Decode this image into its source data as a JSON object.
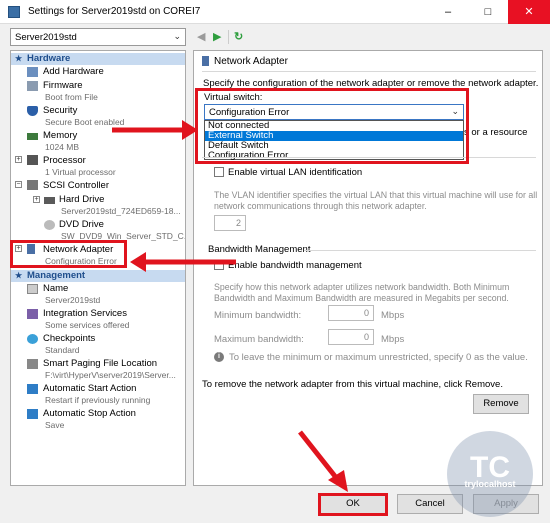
{
  "window": {
    "title": "Settings for Server2019std on COREI7",
    "minimize": "–",
    "maximize": "□",
    "close": "✕"
  },
  "vm_select": {
    "value": "Server2019std"
  },
  "toolbar": {
    "back": "◀",
    "forward": "▶",
    "refresh": "↻"
  },
  "sidebar": {
    "hardware_header": "Hardware",
    "management_header": "Management",
    "items": [
      {
        "label": "Add Hardware",
        "sub": ""
      },
      {
        "label": "Firmware",
        "sub": "Boot from File"
      },
      {
        "label": "Security",
        "sub": "Secure Boot enabled"
      },
      {
        "label": "Memory",
        "sub": "1024 MB"
      },
      {
        "label": "Processor",
        "sub": "1 Virtual processor"
      },
      {
        "label": "SCSI Controller",
        "sub": ""
      },
      {
        "label": "Hard Drive",
        "sub": "Server2019std_724ED659-18..."
      },
      {
        "label": "DVD Drive",
        "sub": "SW_DVD9_Win_Server_STD_C..."
      },
      {
        "label": "Network Adapter",
        "sub": "Configuration Error"
      }
    ],
    "management": [
      {
        "label": "Name",
        "sub": "Server2019std"
      },
      {
        "label": "Integration Services",
        "sub": "Some services offered"
      },
      {
        "label": "Checkpoints",
        "sub": "Standard"
      },
      {
        "label": "Smart Paging File Location",
        "sub": "F:\\virt\\HyperV\\server2019\\Server..."
      },
      {
        "label": "Automatic Start Action",
        "sub": "Restart if previously running"
      },
      {
        "label": "Automatic Stop Action",
        "sub": "Save"
      }
    ]
  },
  "main": {
    "title": "Network Adapter",
    "description": "Specify the configuration of the network adapter or remove the network adapter.",
    "virtual_switch_label": "Virtual switch:",
    "virtual_switch_value": "Configuration Error",
    "switch_options": [
      "Not connected",
      "External Switch",
      "Default Switch",
      "Configuration Error"
    ],
    "selected_option": "External Switch",
    "obscured_text": "s or a resource",
    "vlan_checkbox": "Enable virtual LAN identification",
    "vlan_desc_1": "The VLAN identifier specifies the virtual LAN that this virtual machine will use for all",
    "vlan_desc_2": "network communications through this network adapter.",
    "vlan_value": "2",
    "bandwidth_header": "Bandwidth Management",
    "bandwidth_checkbox": "Enable bandwidth management",
    "bw_desc_1": "Specify how this network adapter utilizes network bandwidth. Both Minimum",
    "bw_desc_2": "Bandwidth and Maximum Bandwidth are measured in Megabits per second.",
    "min_label": "Minimum bandwidth:",
    "max_label": "Maximum bandwidth:",
    "min_value": "0",
    "max_value": "0",
    "unit": "Mbps",
    "info_text": "To leave the minimum or maximum unrestricted, specify 0 as the value.",
    "remove_text": "To remove the network adapter from this virtual machine, click Remove.",
    "remove_button": "Remove"
  },
  "footer": {
    "ok": "OK",
    "cancel": "Cancel",
    "apply": "Apply"
  },
  "watermark": {
    "logo": "TC",
    "sub": "trylocalhost"
  },
  "colors": {
    "accent": "#0078d7",
    "highlight_red": "#e0141e",
    "section_blue": "#1f4e8c"
  }
}
